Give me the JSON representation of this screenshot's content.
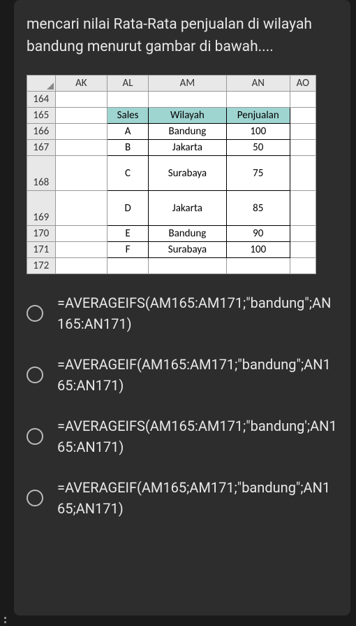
{
  "question": "mencari nilai Rata-Rata penjualan di wilayah bandung menurut gambar di bawah....",
  "columns": [
    "AK",
    "AL",
    "AM",
    "AN",
    "AO"
  ],
  "rowNums": [
    "164",
    "165",
    "166",
    "167",
    "168",
    "169",
    "170",
    "171",
    "172"
  ],
  "tableHeader": [
    "Sales",
    "Wilayah",
    "Penjualan"
  ],
  "rows": [
    {
      "sales": "A",
      "wilayah": "Bandung",
      "penjualan": "100"
    },
    {
      "sales": "B",
      "wilayah": "Jakarta",
      "penjualan": "50"
    },
    {
      "sales": "C",
      "wilayah": "Surabaya",
      "penjualan": "75"
    },
    {
      "sales": "D",
      "wilayah": "Jakarta",
      "penjualan": "85"
    },
    {
      "sales": "E",
      "wilayah": "Bandung",
      "penjualan": "90"
    },
    {
      "sales": "F",
      "wilayah": "Surabaya",
      "penjualan": "100"
    }
  ],
  "options": [
    "=AVERAGEIFS(AM165:AM171;\"bandung\";AN165:AN171)",
    "=AVERAGEIF(AM165:AM171;\"bandung\";AN165:AN171)",
    "=AVERAGEIFS(AM165:AM171;\"bandung';AN165:AN171)",
    "=AVERAGEIF(AM165;AM171;\"bandung\";AN165;AN171)"
  ]
}
